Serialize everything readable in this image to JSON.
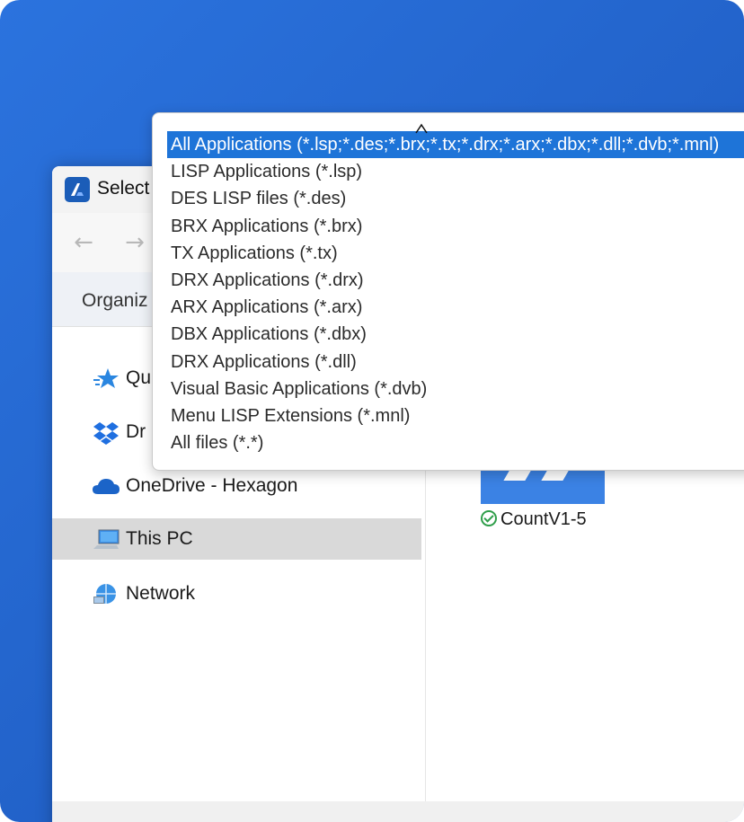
{
  "dialog": {
    "title": "Select",
    "nav_back": "←",
    "nav_forward": "→",
    "organize_label": "Organiz"
  },
  "nav_pane": {
    "items": [
      {
        "label": "Qu",
        "icon": "star-icon",
        "selected": false
      },
      {
        "label": "Dr",
        "icon": "dropbox-icon",
        "selected": false
      },
      {
        "label": "OneDrive - Hexagon",
        "icon": "cloud-icon",
        "selected": false
      },
      {
        "label": "This PC",
        "icon": "computer-icon",
        "selected": true
      },
      {
        "label": "Network",
        "icon": "network-icon",
        "selected": false
      }
    ]
  },
  "content": {
    "file_name": "CountV1-5",
    "sync_status_icon": "check-circle-icon"
  },
  "file_type_dropdown": {
    "selected_index": 0,
    "options": [
      "All Applications (*.lsp;*.des;*.brx;*.tx;*.drx;*.arx;*.dbx;*.dll;*.dvb;*.mnl)",
      "LISP Applications (*.lsp)",
      "DES LISP files (*.des)",
      "BRX Applications (*.brx)",
      "TX Applications (*.tx)",
      "DRX Applications (*.drx)",
      "ARX Applications (*.arx)",
      "DBX Applications (*.dbx)",
      "DRX Applications (*.dll)",
      "Visual Basic Applications (*.dvb)",
      "Menu LISP Extensions (*.mnl)",
      "All files (*.*)"
    ]
  },
  "colors": {
    "background": "#2262c9",
    "selection": "#1e74d8",
    "thumbnail": "#3b82e4",
    "sync_ok": "#2f9e4a"
  }
}
